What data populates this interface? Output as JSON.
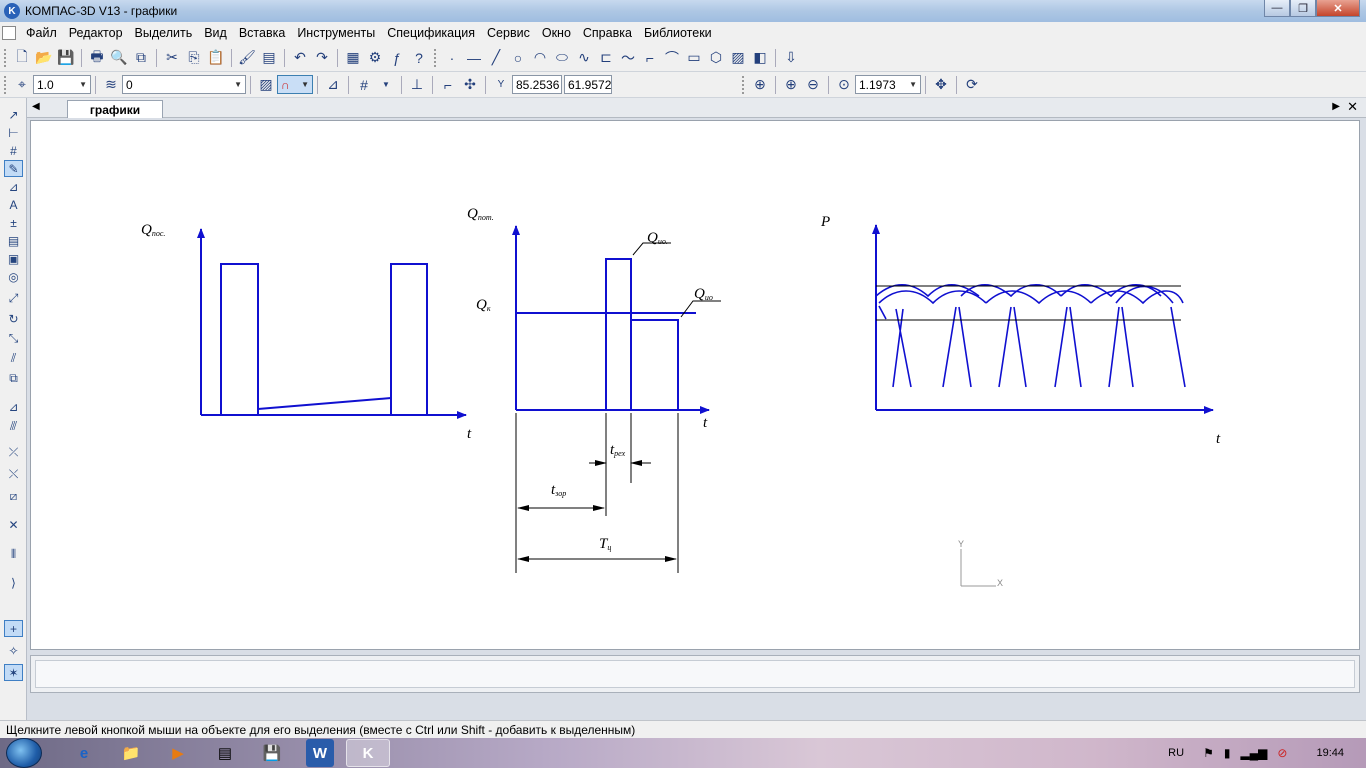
{
  "window": {
    "title": "КОМПАС-3D V13 - графики",
    "app_logo_letter": "K",
    "buttons": [
      "—",
      "❐",
      "✕"
    ]
  },
  "menu": [
    "Файл",
    "Редактор",
    "Выделить",
    "Вид",
    "Вставка",
    "Инструменты",
    "Спецификация",
    "Сервис",
    "Окно",
    "Справка",
    "Библиотеки"
  ],
  "toolbar2": {
    "line_style": "1.0",
    "layer": "0",
    "coord_label": "Y",
    "x": "85.2536",
    "y": "61.9572",
    "zoom": "1.1973"
  },
  "document": {
    "tab": "графики"
  },
  "drawing": {
    "graph1": {
      "y_label": "Q",
      "y_sub": "пос.",
      "x_label": "t"
    },
    "graph2": {
      "y_label": "Q",
      "y_sub": "пот.",
      "peak_label": "Q",
      "peak_sub": "ио.",
      "mid_label": "Q",
      "mid_sub": "ио",
      "k_label": "Q",
      "k_sub": "к",
      "x_label": "t",
      "t_rex": "t",
      "t_rex_sub": "рех",
      "t_zor": "t",
      "t_zor_sub": "зор",
      "t_cycle": "T",
      "t_cycle_sub": "ц"
    },
    "graph3": {
      "y_label": "P",
      "x_label": "t"
    },
    "axis_y": "Y",
    "axis_x": "X",
    "color": "#1010d0"
  },
  "status": {
    "hint": "Щелкните левой кнопкой мыши на объекте для его выделения (вместе с Ctrl или Shift - добавить к выделенным)"
  },
  "taskbar": {
    "lang": "RU",
    "time": "19:44",
    "apps": [
      "e",
      "📁",
      "▶",
      "▤",
      "💾",
      "W",
      "K"
    ]
  }
}
